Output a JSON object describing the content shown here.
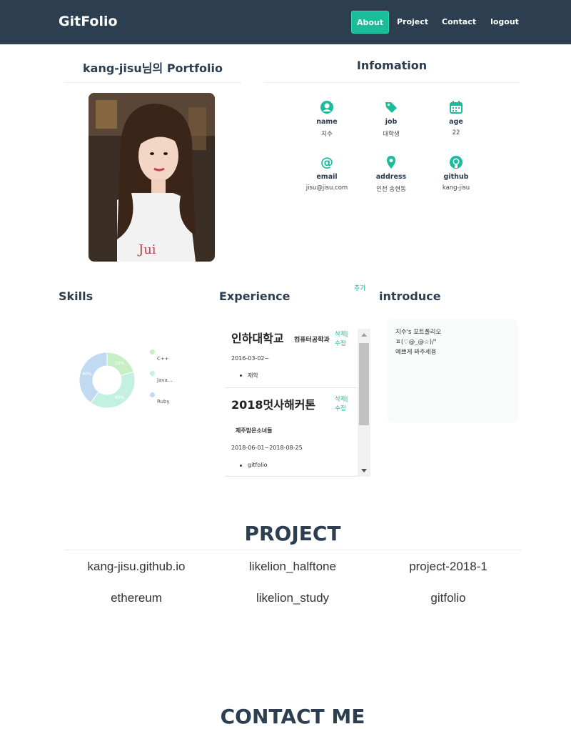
{
  "nav": {
    "brand": "GitFolio",
    "links": [
      "About",
      "Project",
      "Contact",
      "logout"
    ]
  },
  "portfolio": {
    "title": "kang-jisu님의 Portfolio"
  },
  "info": {
    "title": "Infomation",
    "items": [
      {
        "label": "name",
        "value": "지수",
        "icon": "user-circle-icon"
      },
      {
        "label": "job",
        "value": "대학생",
        "icon": "tag-icon"
      },
      {
        "label": "age",
        "value": "22",
        "icon": "calendar-icon"
      },
      {
        "label": "email",
        "value": "jisu@jisu.com",
        "icon": "at-icon"
      },
      {
        "label": "address",
        "value": "인천 송현동",
        "icon": "map-marker-icon"
      },
      {
        "label": "github",
        "value": "kang-jisu",
        "icon": "github-icon"
      }
    ]
  },
  "skills": {
    "title": "Skills",
    "chart_data": {
      "type": "pie",
      "categories": [
        "C++",
        "Java...",
        "Ruby"
      ],
      "values": [
        20,
        40,
        40
      ],
      "labels": [
        "20%",
        "40%",
        "40%"
      ],
      "colors": [
        "#c7eec4",
        "#c4f0e2",
        "#c2d9f2"
      ],
      "legend": "right"
    }
  },
  "experience": {
    "title": "Experience",
    "add_label": "추가",
    "items": [
      {
        "name": "인하대학교",
        "sub": "컴퓨터공학과",
        "date": "2016-03-02~",
        "bullet": "재학",
        "delete": "삭제|",
        "edit": "수정"
      },
      {
        "name": "2018멋사해커톤",
        "sub": "제주맘은소녀들",
        "date": "2018-06-01~2018-08-25",
        "bullet": "gitfolio",
        "delete": "삭제|",
        "edit": "수정"
      }
    ]
  },
  "introduce": {
    "title": "introduce",
    "lines": [
      "지수's 포트폴리오",
      "ㅍ(♡@_@☆)/\"",
      "예쁘게 봐주세용"
    ]
  },
  "project": {
    "title": "PROJECT",
    "items": [
      "kang-jisu.github.io",
      "likelion_halftone",
      "project-2018-1",
      "ethereum",
      "likelion_study",
      "gitfolio"
    ]
  },
  "contact": {
    "title": "CONTACT ME"
  },
  "colors": {
    "navbar": "#2c3e50",
    "accent": "#1abc9c"
  }
}
